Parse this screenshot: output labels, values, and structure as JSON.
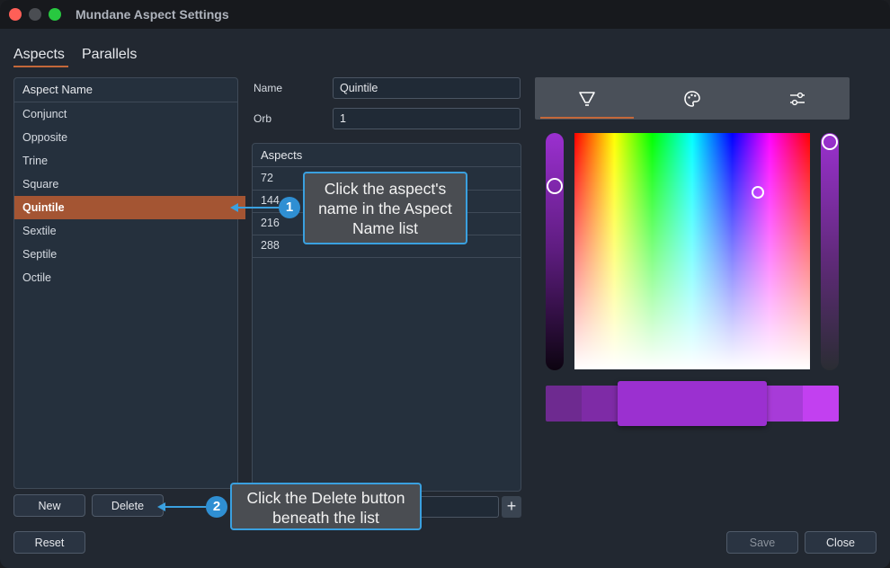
{
  "window": {
    "title": "Mundane Aspect Settings"
  },
  "tabs": [
    {
      "label": "Aspects"
    },
    {
      "label": "Parallels"
    }
  ],
  "aspect_list": {
    "header": "Aspect Name",
    "items": [
      {
        "label": "Conjunct"
      },
      {
        "label": "Opposite"
      },
      {
        "label": "Trine"
      },
      {
        "label": "Square"
      },
      {
        "label": "Quintile"
      },
      {
        "label": "Sextile"
      },
      {
        "label": "Septile"
      },
      {
        "label": "Octile"
      }
    ],
    "selected": "Quintile"
  },
  "form": {
    "name_label": "Name",
    "name_value": "Quintile",
    "orb_label": "Orb",
    "orb_value": "1"
  },
  "aspects_table": {
    "header": "Aspects",
    "rows": [
      "72",
      "144",
      "216",
      "288"
    ]
  },
  "buttons": {
    "new": "New",
    "delete": "Delete",
    "reset": "Reset",
    "save": "Save",
    "close": "Close",
    "add": "+"
  },
  "callouts": [
    {
      "number": "1",
      "text": "Click the aspect's name in the Aspect Name list"
    },
    {
      "number": "2",
      "text": "Click the Delete button beneath the list"
    }
  ],
  "color_picker": {
    "tabs": [
      {
        "icon": "color-wheel-funnel-icon"
      },
      {
        "icon": "palette-icon"
      },
      {
        "icon": "sliders-icon"
      }
    ],
    "active_tab": 0,
    "selected_color": "#9b30d0"
  },
  "colors": {
    "accent": "#c4683a",
    "selection": "#a45533",
    "callout_border": "#3aa0df"
  }
}
